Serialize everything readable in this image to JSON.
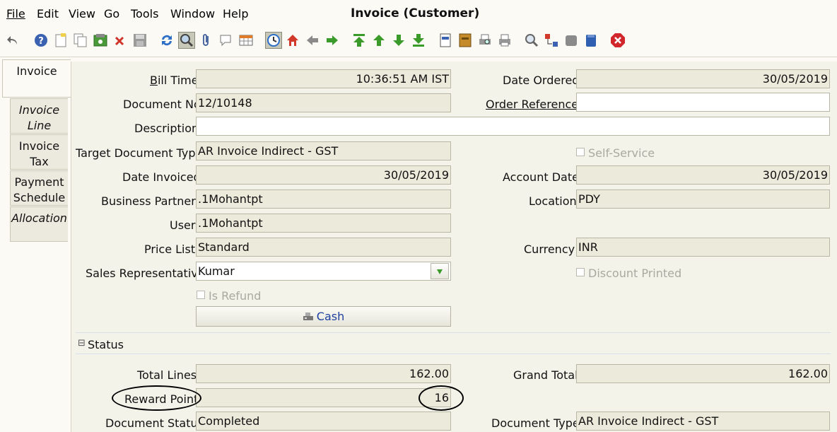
{
  "window": {
    "title": "Invoice (Customer)"
  },
  "menu": [
    "File",
    "Edit",
    "View",
    "Go",
    "Tools",
    "Window",
    "Help"
  ],
  "toolbar": {
    "icons": [
      "undo-icon",
      "help-icon",
      "new-record-icon",
      "copy-record-icon",
      "save-icon",
      "delete-icon",
      "disk-icon",
      "refresh-icon",
      "find-icon",
      "attachment-icon",
      "chat-icon",
      "grid-toggle-icon",
      "history-icon",
      "home-icon",
      "back-icon",
      "forward-icon",
      "first-record-icon",
      "previous-record-icon",
      "next-record-icon",
      "last-record-icon",
      "report-icon",
      "archive-icon",
      "print-preview-icon",
      "print-icon",
      "zoom-across-icon",
      "workflow-icon",
      "product-info-icon",
      "lock-icon",
      "exit-icon"
    ]
  },
  "tabs": [
    {
      "label_1": "Invoice",
      "label_2": ""
    },
    {
      "label_1": "Invoice",
      "label_2": "Line"
    },
    {
      "label_1": "Invoice",
      "label_2": "Tax"
    },
    {
      "label_1": "Payment",
      "label_2": "Schedule"
    },
    {
      "label_1": "Allocation",
      "label_2": ""
    }
  ],
  "form": {
    "bill_time": {
      "label": "Bill Time",
      "value": "10:36:51 AM IST"
    },
    "date_ordered": {
      "label": "Date Ordered",
      "value": "30/05/2019"
    },
    "document_no": {
      "label": "Document No",
      "value": "12/10148"
    },
    "order_reference": {
      "label": "Order Reference",
      "value": ""
    },
    "description": {
      "label": "Description",
      "value": ""
    },
    "target_document_type": {
      "label": "Target Document Type",
      "value": "AR Invoice Indirect - GST"
    },
    "self_service": {
      "label": "Self-Service",
      "checked": false
    },
    "date_invoiced": {
      "label": "Date Invoiced",
      "value": "30/05/2019"
    },
    "account_date": {
      "label": "Account Date",
      "value": "30/05/2019"
    },
    "business_partner": {
      "label": "Business Partner",
      "value": ".1Mohantpt"
    },
    "location": {
      "label": "Location",
      "value": "PDY"
    },
    "user": {
      "label": "User",
      "value": ".1Mohantpt"
    },
    "price_list": {
      "label": "Price List",
      "value": "Standard"
    },
    "currency": {
      "label": "Currency",
      "value": "INR"
    },
    "sales_representative": {
      "label": "Sales Representative",
      "value": "Kumar"
    },
    "discount_printed": {
      "label": "Discount Printed",
      "checked": false
    },
    "is_refund": {
      "label": "Is Refund",
      "checked": false
    },
    "cash_button": {
      "label": "Cash"
    }
  },
  "status_section": {
    "title": "Status",
    "collapse_glyph": "⊟",
    "total_lines": {
      "label": "Total Lines",
      "value": "162.00"
    },
    "grand_total": {
      "label": "Grand Total",
      "value": "162.00"
    },
    "reward_point": {
      "label": "Reward Point",
      "value": "16"
    },
    "document_status": {
      "label": "Document Status",
      "value": "Completed"
    },
    "document_type": {
      "label": "Document Type",
      "value": "AR Invoice Indirect - GST"
    }
  }
}
